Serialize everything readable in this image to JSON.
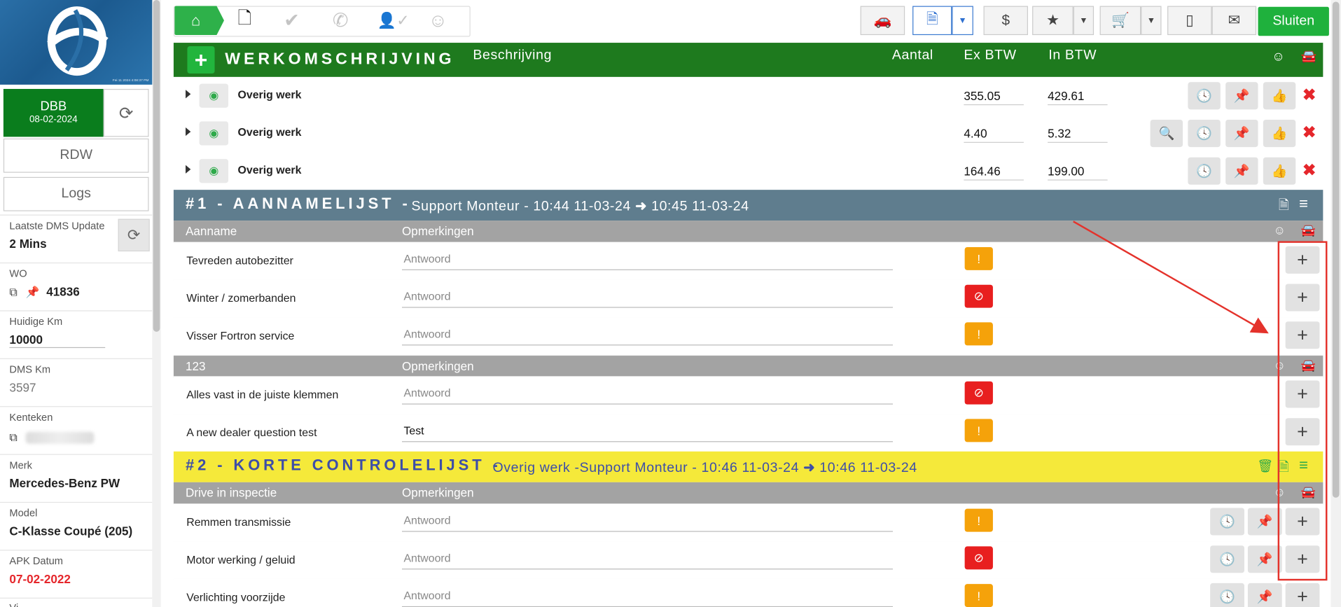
{
  "sidebar": {
    "logo_stamp": "Fei 11 2024 4:08:37 PM",
    "dbb_title": "DBB",
    "dbb_date": "08-02-2024",
    "rdw_label": "RDW",
    "logs_label": "Logs",
    "fields": {
      "dms_update_label": "Laatste DMS Update",
      "dms_update_value": "2 Mins",
      "wo_label": "WO",
      "wo_value": "41836",
      "km_label": "Huidige Km",
      "km_value": "10000",
      "dms_km_label": "DMS Km",
      "dms_km_value": "3597",
      "kenteken_label": "Kenteken",
      "merk_label": "Merk",
      "merk_value": "Mercedes-Benz PW",
      "model_label": "Model",
      "model_value": "C-Klasse Coupé (205)",
      "apk_label": "APK Datum",
      "apk_value": "07-02-2022",
      "next_label": "Vi"
    }
  },
  "toolbar": {
    "workflow_icons": [
      "garage-icon",
      "document-icon",
      "check-icon",
      "phone-icon",
      "user-check-icon",
      "smiley-icon"
    ],
    "buttons": [
      "car-wrench-icon",
      "document-icon",
      "dollar-icon",
      "star-icon",
      "cart-icon",
      "tablet-icon",
      "envelope-icon"
    ],
    "dollar_glyph": "$",
    "close_label": "Sluiten"
  },
  "werk": {
    "title": "WERKOMSCHRIJVING",
    "col_desc": "Beschrijving",
    "col_qty": "Aantal",
    "col_ex": "Ex BTW",
    "col_in": "In BTW",
    "rows": [
      {
        "name": "Overig werk",
        "ex": "355.05",
        "in": "429.61"
      },
      {
        "name": "Overig werk",
        "ex": "4.40",
        "in": "5.32"
      },
      {
        "name": "Overig werk",
        "ex": "164.46",
        "in": "199.00"
      }
    ]
  },
  "section1": {
    "title": "#1 - AANNAMELIJST -",
    "subtitle_a": "Support Monteur - 10:44 11-03-24",
    "subtitle_b": "10:45 11-03-24",
    "color": "#5f7d8e",
    "groups": [
      {
        "col_a": "Aanname",
        "col_b": "Opmerkingen",
        "items": [
          {
            "q": "Tevreden autobezitter",
            "a": "Antwoord",
            "status": "orange"
          },
          {
            "q": "Winter / zomerbanden",
            "a": "Antwoord",
            "status": "red"
          },
          {
            "q": "Visser Fortron service",
            "a": "Antwoord",
            "status": "orange"
          }
        ]
      },
      {
        "col_a": "123",
        "col_b": "Opmerkingen",
        "items": [
          {
            "q": "Alles vast in de juiste klemmen",
            "a": "Antwoord",
            "status": "red"
          },
          {
            "q": "A new dealer question test",
            "a": "Test",
            "status": "orange"
          }
        ]
      }
    ]
  },
  "section2": {
    "title": "#2 - KORTE CONTROLELIJST -",
    "subtitle_a": "Overig werk -Support Monteur - 10:46 11-03-24",
    "subtitle_b": "10:46 11-03-24",
    "color": "#f5e93a",
    "col_a": "Drive in inspectie",
    "col_b": "Opmerkingen",
    "items": [
      {
        "q": "Remmen transmissie",
        "a": "Antwoord",
        "status": "orange"
      },
      {
        "q": "Motor werking / geluid",
        "a": "Antwoord",
        "status": "red"
      },
      {
        "q": "Verlichting voorzijde",
        "a": "Antwoord",
        "status": "orange"
      }
    ]
  },
  "colors": {
    "green_header": "#1e7a1e",
    "accent_green": "#1fb13d",
    "badge_orange": "#f5a20a",
    "badge_red": "#e81f1f",
    "annotation_red": "#e4322b"
  }
}
